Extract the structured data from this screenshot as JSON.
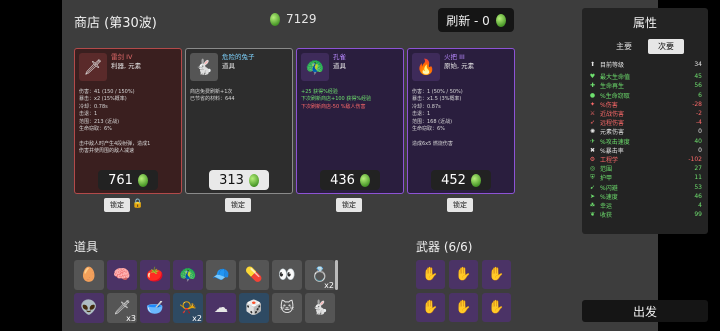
{
  "header": {
    "title": "商店 (第30波)",
    "materials_value": "7129",
    "refresh_label": "刷新 - 0"
  },
  "shop": [
    {
      "name": "雷剑 IV",
      "tags": "利器, 元素",
      "icon": "sword-icon",
      "glyph": "🗡",
      "lines": [
        {
          "t": "伤害：41 (150 / 150%)",
          "c": ""
        },
        {
          "t": "暴击：x2 (15%概率)",
          "c": ""
        },
        {
          "t": "冷却：0.78s",
          "c": ""
        },
        {
          "t": "击退：1",
          "c": ""
        },
        {
          "t": "范围：213 (近战)",
          "c": ""
        },
        {
          "t": "生命窃取：6%",
          "c": ""
        },
        {
          "t": "",
          "c": ""
        },
        {
          "t": "击中敌人时产生4段射弹，造成1",
          "c": ""
        },
        {
          "t": "伤害并使周围的敌人减速",
          "c": ""
        }
      ],
      "price": "761",
      "lock_label": "锁定"
    },
    {
      "name": "危险的兔子",
      "tags": "道具",
      "icon": "rabbit-icon",
      "glyph": "🐇",
      "lines": [
        {
          "t": "商店免费刷新+1次",
          "c": ""
        },
        {
          "t": "已节省的材料：644",
          "c": ""
        }
      ],
      "price": "313",
      "lock_label": "锁定"
    },
    {
      "name": "孔雀",
      "tags": "道具",
      "icon": "peacock-icon",
      "glyph": "🦚",
      "lines": [
        {
          "t": "+25 获得%经验",
          "c": "g"
        },
        {
          "t": "下次刷新商店+100 获得%经验",
          "c": "g"
        },
        {
          "t": "下次刷新商店-50 %敌人伤害",
          "c": "r"
        }
      ],
      "price": "436",
      "lock_label": "锁定"
    },
    {
      "name": "火把 III",
      "tags": "原始, 元素",
      "icon": "torch-icon",
      "glyph": "🔥",
      "lines": [
        {
          "t": "伤害：1 (50% / 50%)",
          "c": ""
        },
        {
          "t": "暴击：x1.5 (3%概率)",
          "c": ""
        },
        {
          "t": "冷却：0.87s",
          "c": ""
        },
        {
          "t": "击退：1",
          "c": ""
        },
        {
          "t": "范围：168 (近战)",
          "c": ""
        },
        {
          "t": "生命窃取：6%",
          "c": ""
        },
        {
          "t": "",
          "c": ""
        },
        {
          "t": "造成6x5 燃烧伤害",
          "c": ""
        }
      ],
      "price": "452",
      "lock_label": "锁定"
    }
  ],
  "items_title": "道具",
  "items": [
    {
      "icon": "egg-icon",
      "glyph": "🥚",
      "color": "white",
      "qty": ""
    },
    {
      "icon": "brain-icon",
      "glyph": "🧠",
      "color": "purple",
      "qty": ""
    },
    {
      "icon": "tomato-icon",
      "glyph": "🍅",
      "color": "purple",
      "qty": ""
    },
    {
      "icon": "peacock-icon",
      "glyph": "🦚",
      "color": "purple",
      "qty": ""
    },
    {
      "icon": "cap-icon",
      "glyph": "🧢",
      "color": "white",
      "qty": ""
    },
    {
      "icon": "pill-icon",
      "glyph": "💊",
      "color": "white",
      "qty": ""
    },
    {
      "icon": "eyes-icon",
      "glyph": "👀",
      "color": "white",
      "qty": ""
    },
    {
      "icon": "ring-icon",
      "glyph": "💍",
      "color": "white",
      "qty": "x2"
    },
    {
      "icon": "alien-icon",
      "glyph": "👽",
      "color": "purple",
      "qty": ""
    },
    {
      "icon": "sword-icon",
      "glyph": "🗡",
      "color": "white",
      "qty": "x3"
    },
    {
      "icon": "bowl-icon",
      "glyph": "🥣",
      "color": "purple",
      "qty": ""
    },
    {
      "icon": "horn-icon",
      "glyph": "📯",
      "color": "blue",
      "qty": "x2"
    },
    {
      "icon": "cloud-icon",
      "glyph": "☁",
      "color": "purple",
      "qty": ""
    },
    {
      "icon": "dice-icon",
      "glyph": "🎲",
      "color": "blue",
      "qty": ""
    },
    {
      "icon": "cat-icon",
      "glyph": "🐱",
      "color": "white",
      "qty": ""
    },
    {
      "icon": "rabbit-icon",
      "glyph": "🐇",
      "color": "white",
      "qty": ""
    }
  ],
  "weapons_title": "武器 (6/6)",
  "weapons": [
    {
      "icon": "hand-icon",
      "glyph": "✋"
    },
    {
      "icon": "hand-icon",
      "glyph": "✋"
    },
    {
      "icon": "hand-icon",
      "glyph": "✋"
    },
    {
      "icon": "hand-icon",
      "glyph": "✋"
    },
    {
      "icon": "hand-icon",
      "glyph": "✋"
    },
    {
      "icon": "hand-icon",
      "glyph": "✋"
    }
  ],
  "stats": {
    "title": "属性",
    "tab_main": "主要",
    "tab_secondary": "次要",
    "level": {
      "label": "目前等级",
      "value": "34",
      "icon": "level-icon",
      "glyph": "⬆"
    },
    "rows": [
      {
        "label": "最大生命值",
        "value": "45",
        "color": "#6ee06e",
        "icon": "heart-icon",
        "glyph": "♥"
      },
      {
        "label": "生命再生",
        "value": "56",
        "color": "#6ee06e",
        "icon": "regen-icon",
        "glyph": "✚"
      },
      {
        "label": "%生命窃取",
        "value": "6",
        "color": "#6ee06e",
        "icon": "lifesteal-icon",
        "glyph": "●"
      },
      {
        "label": "%伤害",
        "value": "-28",
        "color": "#ff6a6a",
        "icon": "damage-icon",
        "glyph": "✦"
      },
      {
        "label": "近战伤害",
        "value": "-2",
        "color": "#ff6a6a",
        "icon": "melee-icon",
        "glyph": "⚔"
      },
      {
        "label": "远程伤害",
        "value": "-4",
        "color": "#ff6a6a",
        "icon": "ranged-icon",
        "glyph": "➶"
      },
      {
        "label": "元素伤害",
        "value": "0",
        "color": "#e6e6e6",
        "icon": "element-icon",
        "glyph": "✺"
      },
      {
        "label": "%攻击速度",
        "value": "40",
        "color": "#6ee06e",
        "icon": "attack-speed-icon",
        "glyph": "✈"
      },
      {
        "label": "%暴击率",
        "value": "0",
        "color": "#e6e6e6",
        "icon": "crit-icon",
        "glyph": "✖"
      },
      {
        "label": "工程学",
        "value": "-102",
        "color": "#ff6a6a",
        "icon": "engineering-icon",
        "glyph": "⚙"
      },
      {
        "label": "范围",
        "value": "27",
        "color": "#6ee06e",
        "icon": "range-icon",
        "glyph": "◎"
      },
      {
        "label": "护甲",
        "value": "11",
        "color": "#6ee06e",
        "icon": "armor-icon",
        "glyph": "⛨"
      },
      {
        "label": "%闪避",
        "value": "53",
        "color": "#6ee06e",
        "icon": "dodge-icon",
        "glyph": "➹"
      },
      {
        "label": "%速度",
        "value": "46",
        "color": "#6ee06e",
        "icon": "speed-icon",
        "glyph": "➤"
      },
      {
        "label": "幸运",
        "value": "4",
        "color": "#6ee06e",
        "icon": "luck-icon",
        "glyph": "☘"
      },
      {
        "label": "收获",
        "value": "99",
        "color": "#6ee06e",
        "icon": "harvest-icon",
        "glyph": "❦"
      }
    ]
  },
  "go_label": "出发"
}
